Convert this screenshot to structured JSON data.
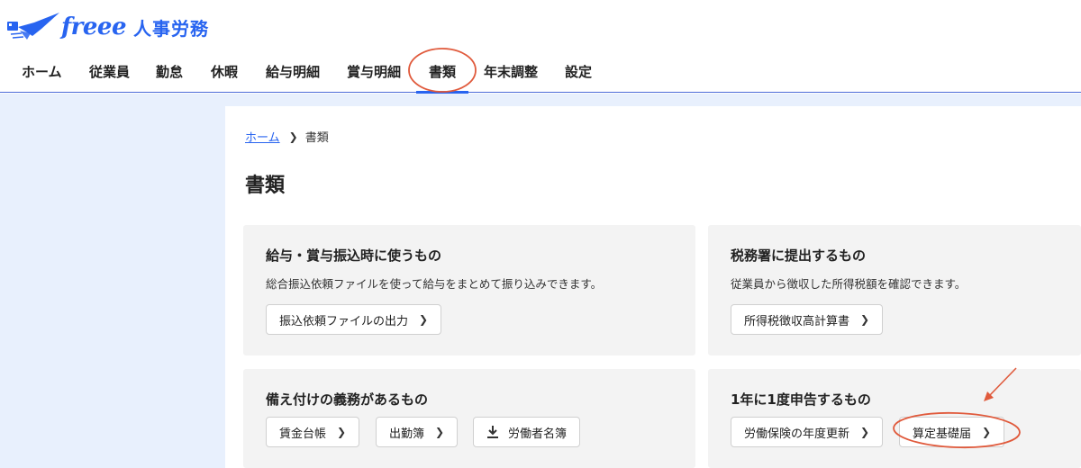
{
  "app": {
    "brand": "freee",
    "product": "人事労務"
  },
  "nav": {
    "items": [
      {
        "label": "ホーム"
      },
      {
        "label": "従業員"
      },
      {
        "label": "勤怠"
      },
      {
        "label": "休暇"
      },
      {
        "label": "給与明細"
      },
      {
        "label": "賞与明細"
      },
      {
        "label": "書類"
      },
      {
        "label": "年末調整"
      },
      {
        "label": "設定"
      }
    ],
    "active": "書類"
  },
  "breadcrumb": {
    "home": "ホーム",
    "current": "書類"
  },
  "page": {
    "title": "書類"
  },
  "cards": [
    {
      "title": "給与・賞与振込時に使うもの",
      "description": "総合振込依頼ファイルを使って給与をまとめて振り込みできます。",
      "buttons": [
        "振込依頼ファイルの出力"
      ]
    },
    {
      "title": "税務署に提出するもの",
      "description": "従業員から徴収した所得税額を確認できます。",
      "buttons": [
        "所得税徴収高計算書"
      ]
    },
    {
      "title": "備え付けの義務があるもの",
      "buttons": [
        "賃金台帳",
        "出勤簿",
        "労働者名簿"
      ]
    },
    {
      "title": "1年に1度申告するもの",
      "buttons": [
        "労働保険の年度更新",
        "算定基礎届"
      ]
    }
  ],
  "colors": {
    "brand": "#2864f0",
    "annotation": "#e05a3c",
    "sidebar_bg": "#e8f0fd",
    "card_bg": "#f3f3f3"
  }
}
